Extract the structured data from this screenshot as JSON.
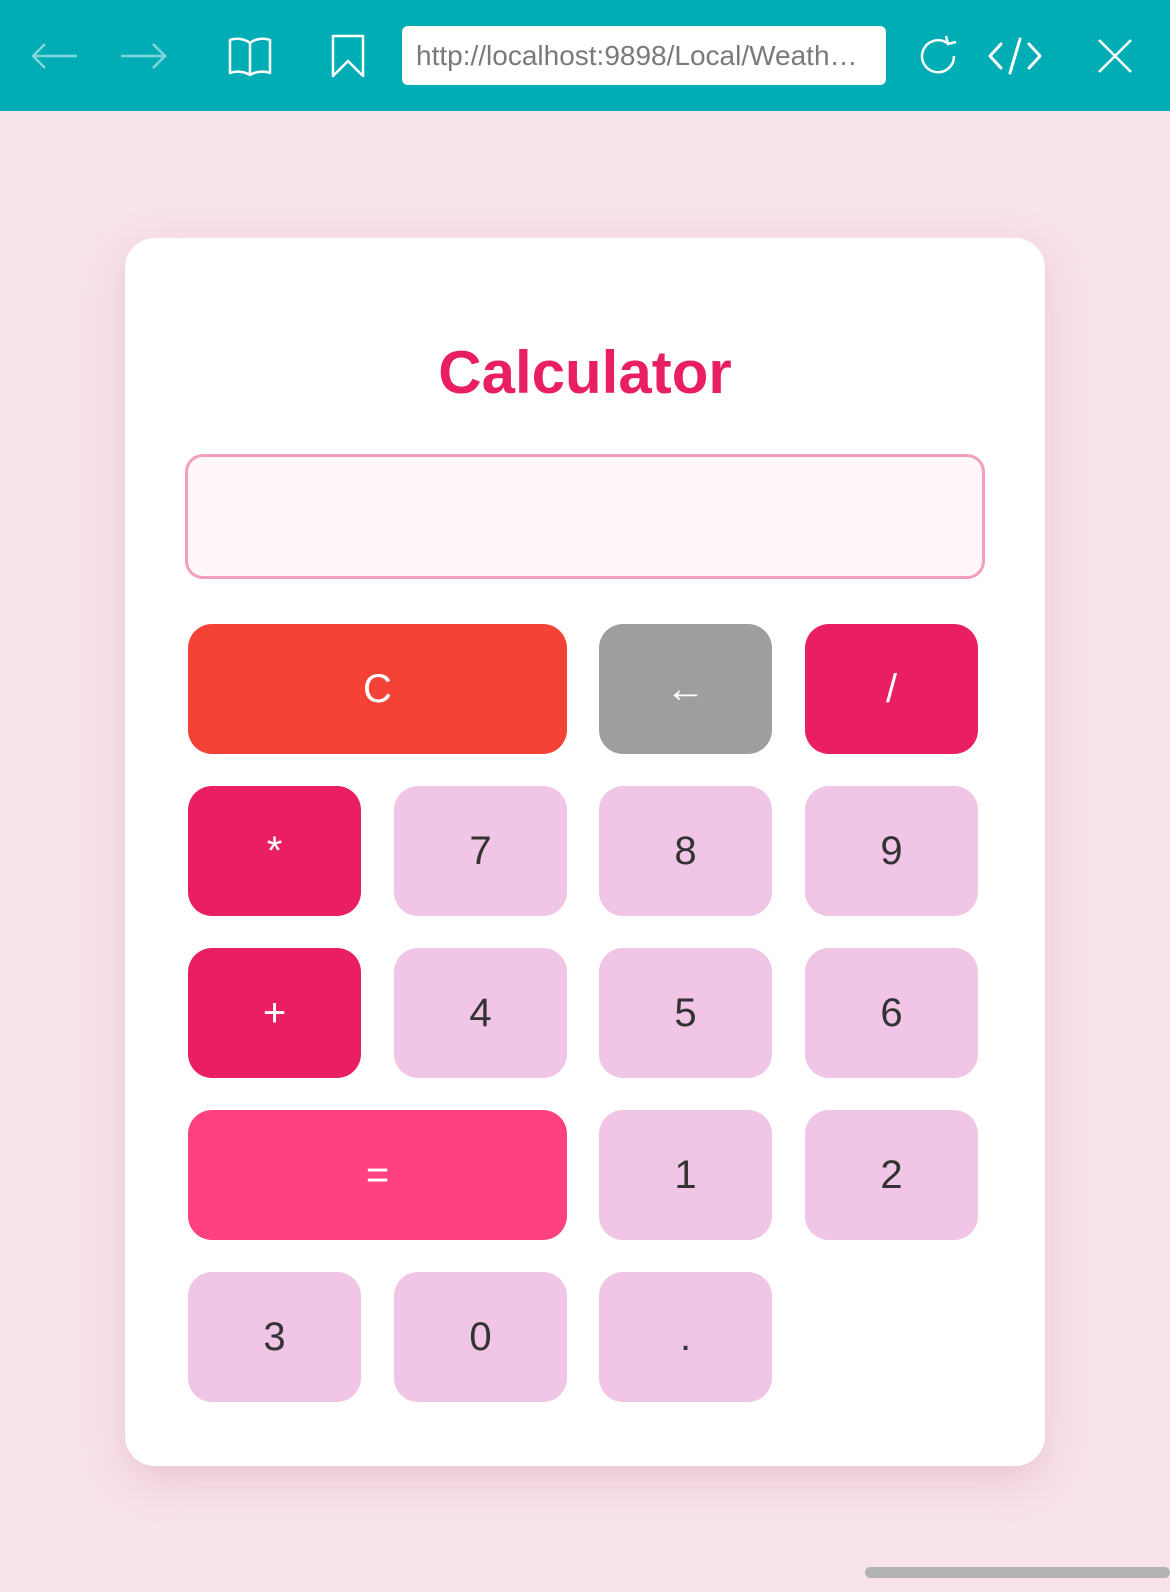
{
  "browser": {
    "url": "http://localhost:9898/Local/Weath…",
    "accent_color": "#00adb5",
    "icons": [
      "arrow-left-icon",
      "arrow-right-icon",
      "book-icon",
      "bookmark-icon",
      "reload-icon",
      "code-icon",
      "close-icon"
    ]
  },
  "calculator": {
    "title": "Calculator",
    "display_value": "",
    "buttons": {
      "clear": "C",
      "backspace": "←",
      "divide": "/",
      "multiply": "*",
      "seven": "7",
      "eight": "8",
      "nine": "9",
      "plus": "+",
      "four": "4",
      "five": "5",
      "six": "6",
      "equals": "=",
      "one": "1",
      "two": "2",
      "three": "3",
      "zero": "0",
      "dot": "."
    },
    "colors": {
      "title": "#e91e63",
      "number": "#f0c5e5",
      "operator": "#e91e63",
      "clear": "#f44336",
      "backspace": "#9e9e9e",
      "equals": "#ff4081",
      "background": "#f9e3eb"
    }
  }
}
